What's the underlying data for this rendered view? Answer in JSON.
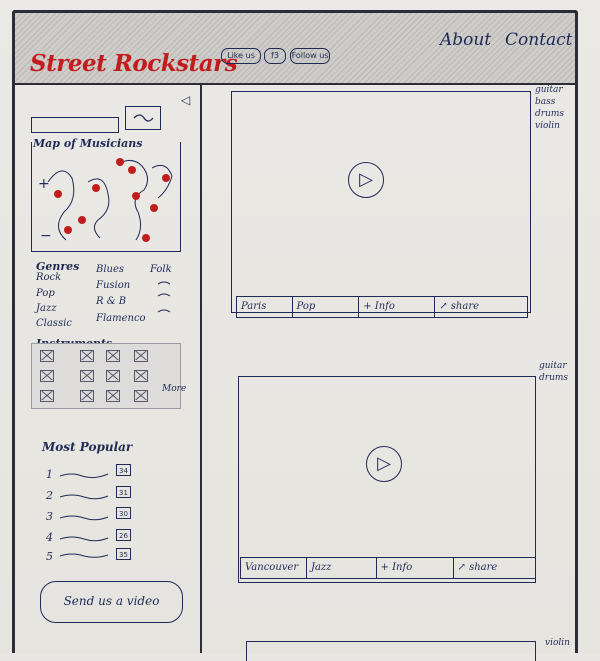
{
  "header": {
    "logo": "Street Rockstars",
    "pills": [
      "Like us",
      "f3",
      "Follow us"
    ],
    "nav": [
      "About",
      "Contact"
    ]
  },
  "sidebar": {
    "search": {
      "placeholder": ""
    },
    "map_title": "Map of Musicians",
    "map_markers": 10,
    "genres_title": "Genres",
    "genres": [
      "Rock",
      "Pop",
      "Jazz",
      "Classic",
      "Blues",
      "Fusion",
      "R & B",
      "Flamenco",
      "Folk"
    ],
    "instruments_title": "Instruments",
    "instruments_more": "More",
    "popular_title": "Most Popular",
    "popular": [
      {
        "rank": "1",
        "count": "34"
      },
      {
        "rank": "2",
        "count": "31"
      },
      {
        "rank": "3",
        "count": "30"
      },
      {
        "rank": "4",
        "count": "26"
      },
      {
        "rank": "5",
        "count": "35"
      }
    ],
    "cta": "Send us a video"
  },
  "videos": [
    {
      "bar": [
        "Paris",
        "Pop",
        "+ Info",
        "↗ share"
      ],
      "tags": [
        "guitar",
        "bass",
        "drums",
        "violin"
      ]
    },
    {
      "bar": [
        "Vancouver",
        "Jazz",
        "+ Info",
        "↗ share"
      ],
      "tags": [
        "guitar",
        "drums"
      ]
    },
    {
      "bar": [],
      "tags": [
        "violin"
      ]
    }
  ],
  "colors": {
    "ink": "#1f2a55",
    "logo_red": "#c21d1d",
    "marker_red": "#c21d1d"
  }
}
